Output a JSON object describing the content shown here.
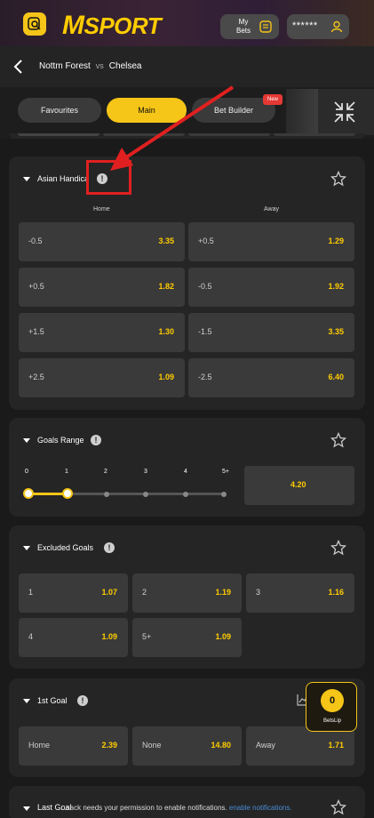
{
  "brand": {
    "logo": "SPORT",
    "logo_m": "M"
  },
  "header": {
    "my_bets_label": "My Bets",
    "masked_balance": "******"
  },
  "match": {
    "home": "Nottm Forest",
    "vs": "vs",
    "away": "Chelsea"
  },
  "tabs": [
    {
      "label": "Favourites",
      "active": false
    },
    {
      "label": "Main",
      "active": true
    },
    {
      "label": "Bet Builder",
      "active": false,
      "badge": "New"
    }
  ],
  "asian_handicap": {
    "title": "Asian Handica",
    "home_label": "Home",
    "away_label": "Away",
    "rows": [
      {
        "home_line": "-0.5",
        "home_odd": "3.35",
        "away_line": "+0.5",
        "away_odd": "1.29"
      },
      {
        "home_line": "+0.5",
        "home_odd": "1.82",
        "away_line": "-0.5",
        "away_odd": "1.92"
      },
      {
        "home_line": "+1.5",
        "home_odd": "1.30",
        "away_line": "-1.5",
        "away_odd": "3.35"
      },
      {
        "home_line": "+2.5",
        "home_odd": "1.09",
        "away_line": "-2.5",
        "away_odd": "6.40"
      }
    ]
  },
  "goals_range": {
    "title": "Goals Range",
    "labels": [
      "0",
      "1",
      "2",
      "3",
      "4",
      "5+"
    ],
    "selected_from": 0,
    "selected_to": 1,
    "odd": "4.20"
  },
  "excluded_goals": {
    "title": "Excluded Goals",
    "options": [
      {
        "label": "1",
        "odd": "1.07"
      },
      {
        "label": "2",
        "odd": "1.19"
      },
      {
        "label": "3",
        "odd": "1.16"
      },
      {
        "label": "4",
        "odd": "1.09"
      },
      {
        "label": "5+",
        "odd": "1.09"
      }
    ]
  },
  "first_goal": {
    "title": "1st Goal",
    "options": [
      {
        "label": "Home",
        "odd": "2.39"
      },
      {
        "label": "None",
        "odd": "14.80"
      },
      {
        "label": "Away",
        "odd": "1.71"
      }
    ]
  },
  "betslip": {
    "count": "0",
    "label": "BetsLip"
  },
  "notification": {
    "partial_title": "Last Goal",
    "text": "...sack needs your permission to enable notifications.",
    "link": "enable notifications."
  },
  "colors": {
    "accent": "#f5c518",
    "odds": "#ffcc00",
    "annotation": "#e02020"
  }
}
